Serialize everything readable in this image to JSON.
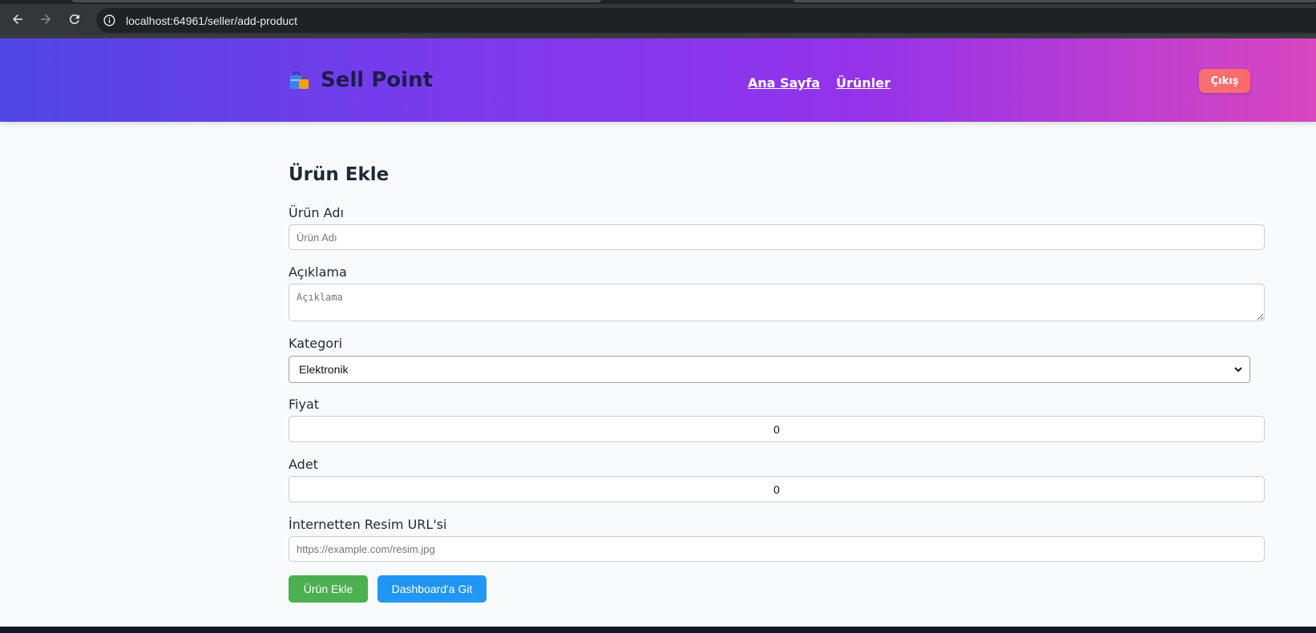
{
  "browser": {
    "url": "localhost:64961/seller/add-product"
  },
  "header": {
    "brand": "Sell Point",
    "nav": [
      {
        "label": "Ana Sayfa"
      },
      {
        "label": "Ürünler"
      }
    ],
    "logout_label": "Çıkış"
  },
  "form": {
    "title": "Ürün Ekle",
    "name": {
      "label": "Ürün Adı",
      "placeholder": "Ürün Adı",
      "value": ""
    },
    "description": {
      "label": "Açıklama",
      "placeholder": "Açıklama",
      "value": ""
    },
    "category": {
      "label": "Kategori",
      "selected": "Elektronik"
    },
    "price": {
      "label": "Fiyat",
      "value": "0"
    },
    "quantity": {
      "label": "Adet",
      "value": "0"
    },
    "image_url": {
      "label": "İnternetten Resim URL'si",
      "placeholder": "https://example.com/resim.jpg",
      "value": ""
    },
    "submit_label": "Ürün Ekle",
    "dashboard_label": "Dashboard'a Git"
  },
  "colors": {
    "header_gradient_start": "#4f46e5",
    "header_gradient_end": "#d946c0",
    "logout": "#f87171",
    "submit": "#4caf50",
    "dashboard": "#2196f3"
  },
  "icons": {
    "brand": "shopping-bags-icon",
    "back": "arrow-left-icon",
    "forward": "arrow-right-icon",
    "reload": "reload-icon",
    "site_info": "info-icon",
    "select": "chevron-down-icon"
  }
}
